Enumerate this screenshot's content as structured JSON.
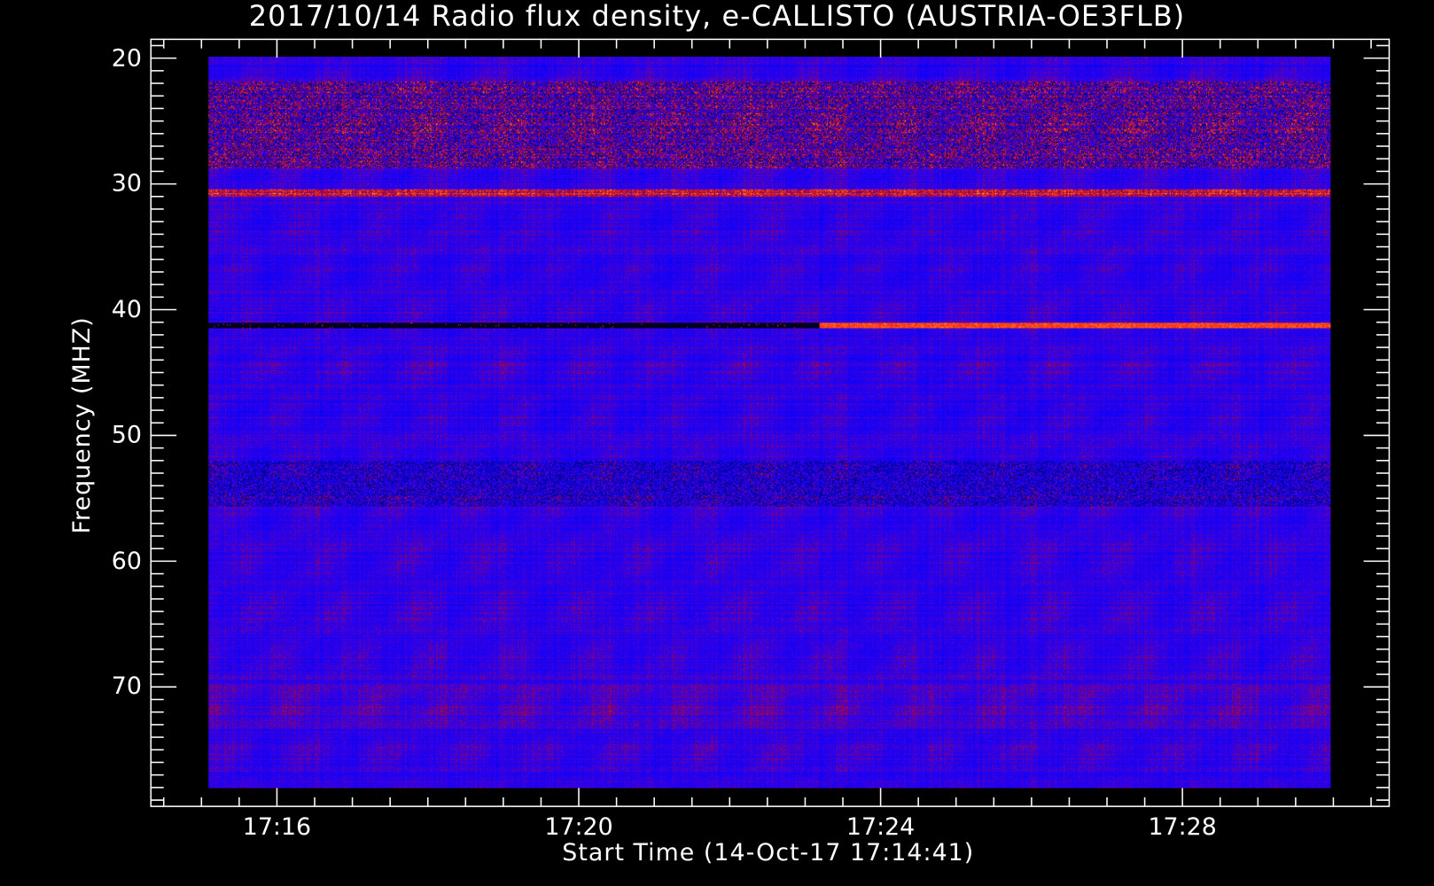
{
  "chart_data": {
    "type": "heatmap",
    "title": "2017/10/14  Radio flux density, e-CALLISTO (AUSTRIA-OE3FLB)",
    "xlabel": "Start Time (14-Oct-17 17:14:41)",
    "ylabel": "Frequency (MHZ)",
    "x_unit": "minutes after 17:00",
    "xlim": [
      14.33,
      30.74
    ],
    "data_xrange": [
      15.1,
      30.0
    ],
    "ylim": [
      79.5,
      18.5
    ],
    "data_yrange": [
      20,
      79.4
    ],
    "x_major_ticks": [
      16,
      20,
      24,
      28
    ],
    "x_tick_labels": [
      "17:16",
      "17:20",
      "17:24",
      "17:28"
    ],
    "x_minor_step": 0.5,
    "y_major_ticks": [
      20,
      30,
      40,
      50,
      60,
      70
    ],
    "y_tick_labels": [
      "20",
      "30",
      "40",
      "50",
      "60",
      "70"
    ],
    "y_minor_step": 1,
    "colormap": [
      "#000000",
      "#0000ff",
      "#800080",
      "#ff0000",
      "#ff8000",
      "#ffff80"
    ],
    "background_level": "blue",
    "features": [
      {
        "name": "strong interference band",
        "freq_mhz": [
          22,
          29
        ],
        "level": "red-orange"
      },
      {
        "name": "narrow interference line",
        "freq_mhz": [
          30.7,
          31.3
        ],
        "level": "orange"
      },
      {
        "name": "carrier line (off)",
        "freq_mhz": [
          41.6,
          42.0
        ],
        "time": [
          15.1,
          23.2
        ],
        "level": "black"
      },
      {
        "name": "carrier line (on)",
        "freq_mhz": [
          41.6,
          42.0
        ],
        "time": [
          23.2,
          30.0
        ],
        "level": "yellow-orange"
      },
      {
        "name": "mixed band",
        "freq_mhz": [
          52.8,
          56.5
        ],
        "level": "dark red / black"
      },
      {
        "name": "weak band",
        "freq_mhz": [
          71,
          74.5
        ],
        "level": "dark red"
      }
    ]
  }
}
